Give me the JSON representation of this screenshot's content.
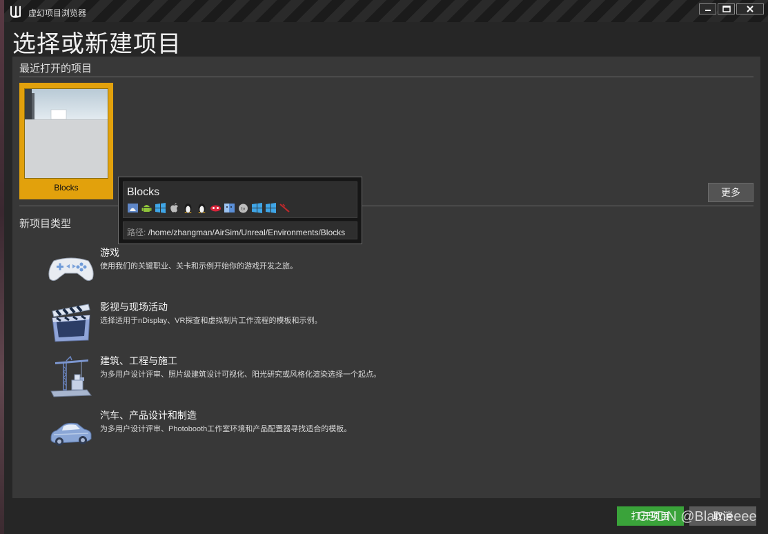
{
  "window": {
    "title": "虚幻项目浏览器",
    "minimize_icon": "minimize-icon",
    "maximize_icon": "maximize-icon",
    "close_icon": "close-icon"
  },
  "page_title": "选择或新建项目",
  "recent": {
    "header": "最近打开的项目",
    "projects": [
      {
        "name": "Blocks",
        "selected": true
      }
    ],
    "more_label": "更多",
    "accent_color": "#e2a10c"
  },
  "tooltip": {
    "name": "Blocks",
    "platform_icons": [
      "linux-mac-icon",
      "android-icon",
      "windows-icon",
      "apple-icon",
      "linux-icon",
      "linux-icon",
      "lumin-icon",
      "mac-icon",
      "tvos-icon",
      "windows-icon",
      "windows-icon",
      "broken-icon"
    ],
    "path_label": "路径:",
    "path_value": "/home/zhangman/AirSim/Unreal/Environments/Blocks"
  },
  "new_types": {
    "title": "新项目类型",
    "items": [
      {
        "name": "游戏",
        "desc": "使用我们的关键职业、关卡和示例开始你的游戏开发之旅。",
        "icon": "gamepad-icon"
      },
      {
        "name": "影视与现场活动",
        "desc": "选择适用于nDisplay、VR探查和虚拟制片工作流程的模板和示例。",
        "icon": "clapperboard-icon"
      },
      {
        "name": "建筑、工程与施工",
        "desc": "为多用户设计评审、照片级建筑设计可视化、阳光研究或风格化渲染选择一个起点。",
        "icon": "crane-icon"
      },
      {
        "name": "汽车、产品设计和制造",
        "desc": "为多用户设计评审、Photobooth工作室环境和产品配置器寻找适合的模板。",
        "icon": "car-icon"
      }
    ]
  },
  "footer": {
    "open_label": "打开项目",
    "cancel_label": "取消",
    "open_color": "#3aa33a"
  },
  "watermark": "CSDN @Blameeee"
}
